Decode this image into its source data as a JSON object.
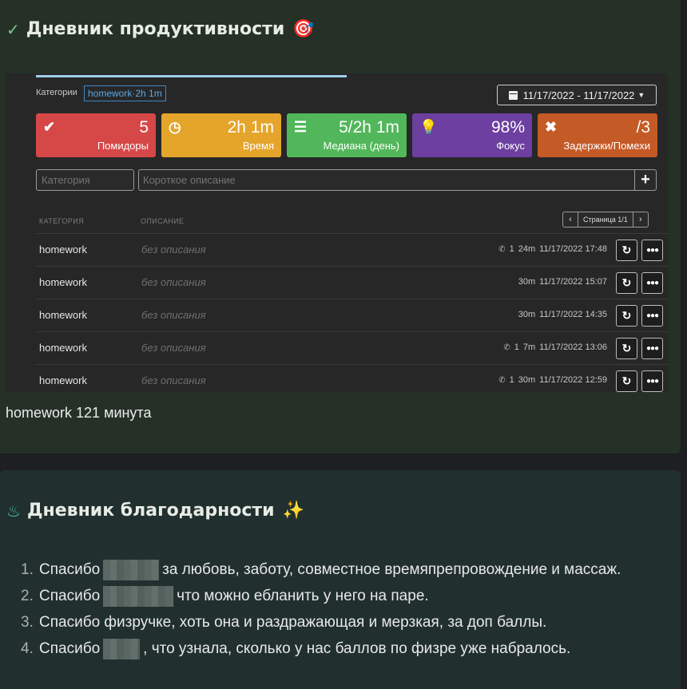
{
  "productivity": {
    "title": "Дневник продуктивности",
    "title_emoji": "🎯",
    "category_label": "Категории",
    "category_chip": "homework·2h 1m",
    "date_range": "11/17/2022 - 11/17/2022",
    "stats": [
      {
        "icon": "check-circle-icon",
        "value": "5",
        "label": "Помидоры",
        "color": "#d64747"
      },
      {
        "icon": "clock-icon",
        "value": "2h 1m",
        "label": "Время",
        "color": "#e5a52b"
      },
      {
        "icon": "list-icon",
        "value": "5/2h 1m",
        "label": "Медиана (день)",
        "color": "#52b75a"
      },
      {
        "icon": "lightbulb-icon",
        "value": "98%",
        "label": "Фокус",
        "color": "#6c3fa0"
      },
      {
        "icon": "x-icon",
        "value": "/3",
        "label": "Задержки/Помехи",
        "color": "#c45a26"
      }
    ],
    "category_placeholder": "Категория",
    "description_placeholder": "Короткое описание",
    "add_label": "+",
    "table": {
      "headers": [
        "КАТЕГОРИЯ",
        "ОПИСАНИЕ"
      ],
      "pager": "Страница 1/1",
      "rows": [
        {
          "category": "homework",
          "description": "без описания",
          "interruptions": "1",
          "duration": "24m",
          "timestamp": "11/17/2022 17:48"
        },
        {
          "category": "homework",
          "description": "без описания",
          "interruptions": "",
          "duration": "30m",
          "timestamp": "11/17/2022 15:07"
        },
        {
          "category": "homework",
          "description": "без описания",
          "interruptions": "",
          "duration": "30m",
          "timestamp": "11/17/2022 14:35"
        },
        {
          "category": "homework",
          "description": "без описания",
          "interruptions": "1",
          "duration": "7m",
          "timestamp": "11/17/2022 13:06"
        },
        {
          "category": "homework",
          "description": "без описания",
          "interruptions": "1",
          "duration": "30m",
          "timestamp": "11/17/2022 12:59"
        }
      ]
    },
    "summary": "homework 121 минута"
  },
  "gratitude": {
    "title": "Дневник благодарности",
    "title_emoji": "✨",
    "items": [
      {
        "num": "1.",
        "before": "Спасибо",
        "after": "за любовь, заботу, совместное времяпрепровождение и массаж."
      },
      {
        "num": "2.",
        "before": "Спасибо",
        "after": "что можно ебланить у него на паре."
      },
      {
        "num": "3.",
        "before": "Спасибо физручке, хоть она и раздражающая и мерзкая, за доп баллы.",
        "after": ""
      },
      {
        "num": "4.",
        "before": "Спасибо",
        "after": ", что узнала, сколько у нас баллов по физре уже набралось."
      }
    ]
  }
}
